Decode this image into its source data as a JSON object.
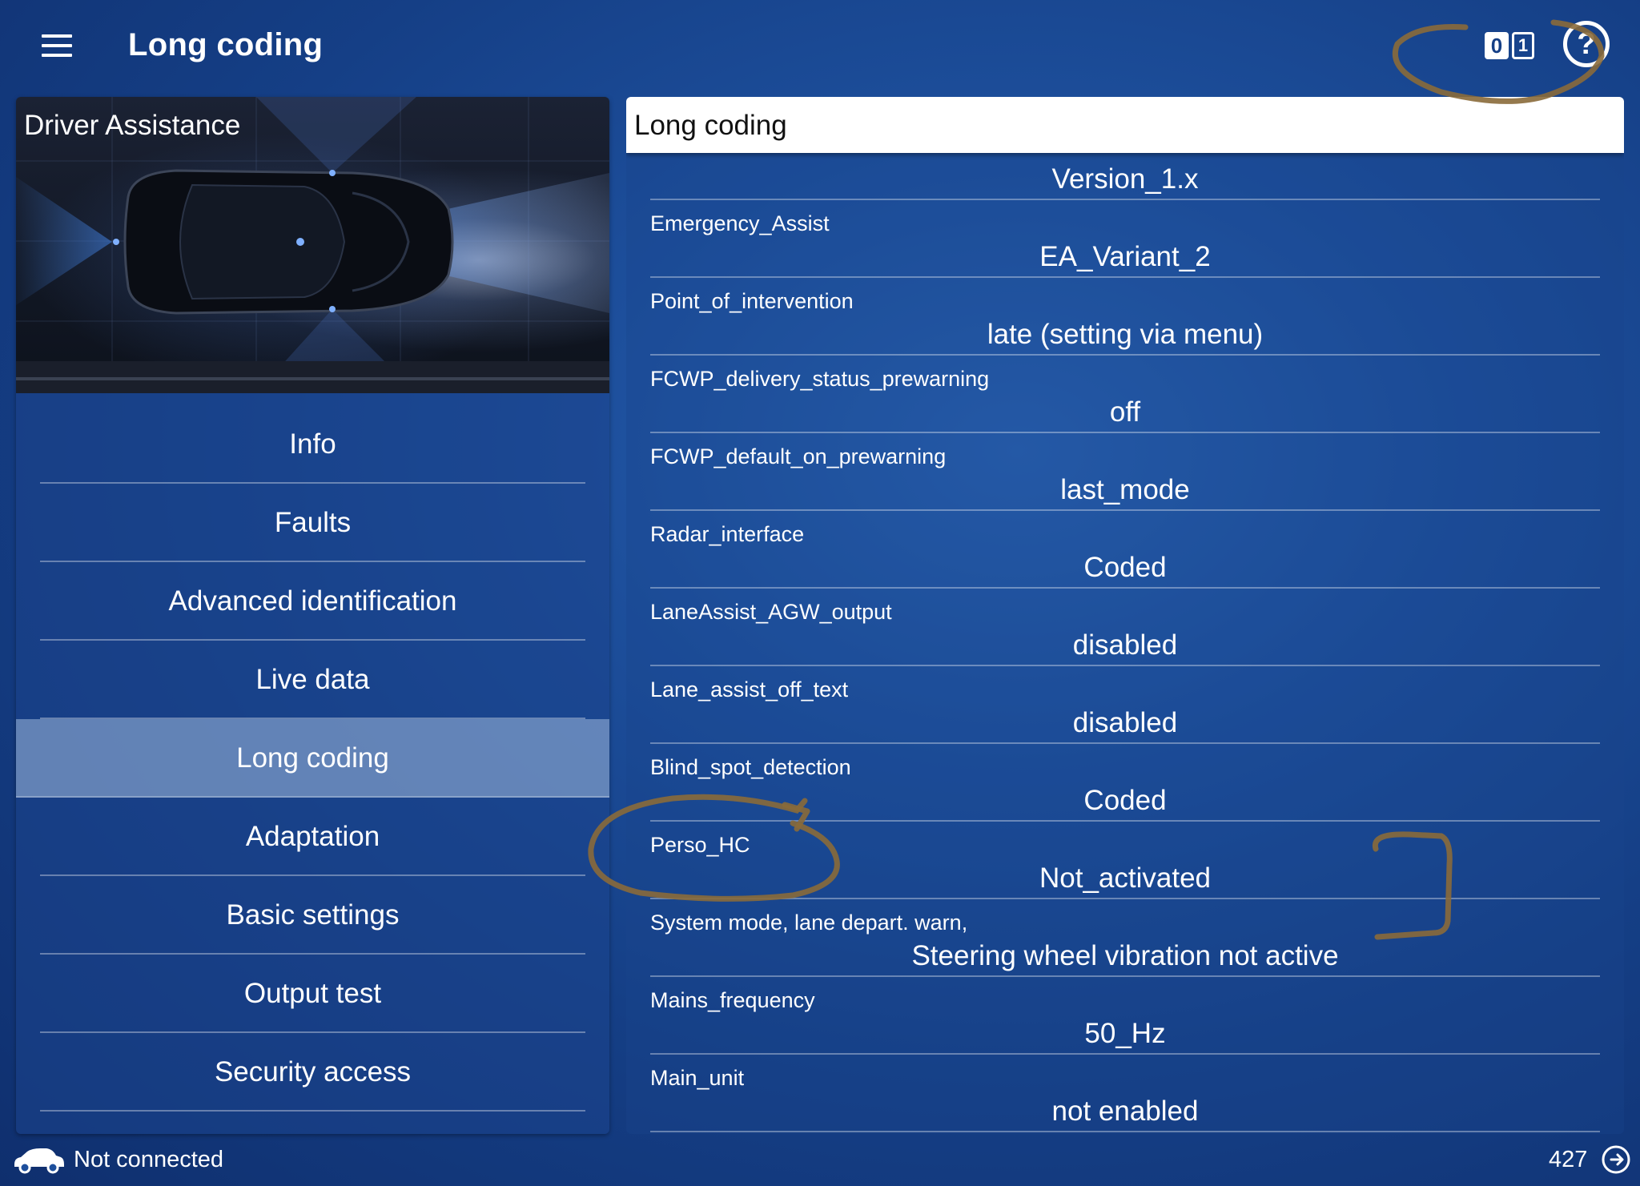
{
  "header": {
    "title": "Long coding",
    "binary_left": "0",
    "binary_right": "1",
    "help": "?"
  },
  "module": {
    "title": "Driver Assistance"
  },
  "nav": {
    "items": [
      {
        "label": "Info"
      },
      {
        "label": "Faults"
      },
      {
        "label": "Advanced identification"
      },
      {
        "label": "Live data"
      },
      {
        "label": "Long coding"
      },
      {
        "label": "Adaptation"
      },
      {
        "label": "Basic settings"
      },
      {
        "label": "Output test"
      },
      {
        "label": "Security access"
      }
    ],
    "active": "Long coding"
  },
  "panel": {
    "title": "Long coding",
    "rows": [
      {
        "name": "",
        "value": "Version_1.x"
      },
      {
        "name": "Emergency_Assist",
        "value": "EA_Variant_2"
      },
      {
        "name": "Point_of_intervention",
        "value": "late (setting via menu)"
      },
      {
        "name": "FCWP_delivery_status_prewarning",
        "value": "off"
      },
      {
        "name": "FCWP_default_on_prewarning",
        "value": "last_mode"
      },
      {
        "name": "Radar_interface",
        "value": "Coded"
      },
      {
        "name": "LaneAssist_AGW_output",
        "value": "disabled"
      },
      {
        "name": "Lane_assist_off_text",
        "value": "disabled"
      },
      {
        "name": "Blind_spot_detection",
        "value": "Coded"
      },
      {
        "name": "Perso_HC",
        "value": "Not_activated"
      },
      {
        "name": "System mode, lane depart. warn,",
        "value": "Steering wheel vibration not active"
      },
      {
        "name": "Mains_frequency",
        "value": "50_Hz"
      },
      {
        "name": "Main_unit",
        "value": "not enabled"
      }
    ]
  },
  "status": {
    "connection": "Not connected",
    "counter": "427"
  },
  "colors": {
    "background": "#1d4f9c",
    "annotation": "#8a6a3a",
    "header_bg": "#ffffff"
  },
  "icons": {
    "menu": "hamburger-menu-icon",
    "binary": "binary-toggle-icon",
    "help": "help-icon",
    "car": "car-icon",
    "exit": "exit-icon"
  }
}
